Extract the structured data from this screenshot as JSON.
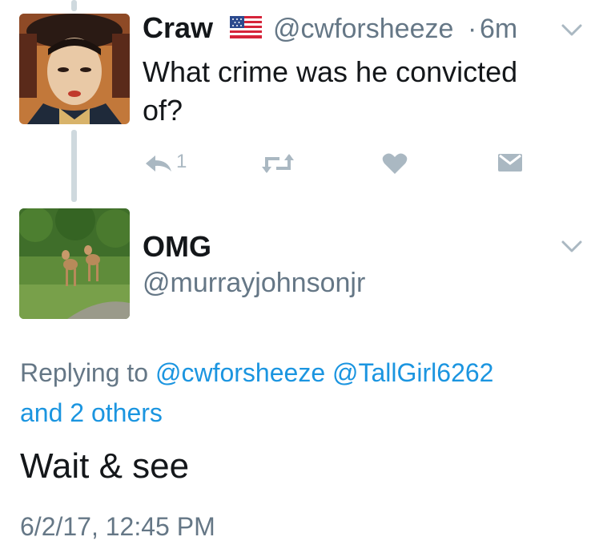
{
  "parent_tweet": {
    "display_name": "Craw",
    "flag": "🇺🇸",
    "handle": "@cwforsheeze",
    "separator": "·",
    "time_ago": "6m",
    "text": "What crime was he convicted of?",
    "text_line1": "What crime was he convicted",
    "text_line2": "of?",
    "reply_count": "1",
    "icons": [
      "reply-icon",
      "retweet-icon",
      "like-icon",
      "direct-message-icon",
      "chevron-down-icon"
    ]
  },
  "main_tweet": {
    "display_name": "OMG",
    "handle": "@murrayjohnsonjr",
    "replying_prefix": "Replying to",
    "replying_mentions": [
      "@cwforsheeze",
      "@TallGirl6262"
    ],
    "replying_others": "and 2 others",
    "text": "Wait & see",
    "timestamp": "6/2/17, 12:45 PM"
  },
  "colors": {
    "text": "#14171a",
    "secondary": "#657786",
    "icon": "#aab8c2",
    "link": "#1b95e0",
    "thread_line": "#cfd9de"
  }
}
